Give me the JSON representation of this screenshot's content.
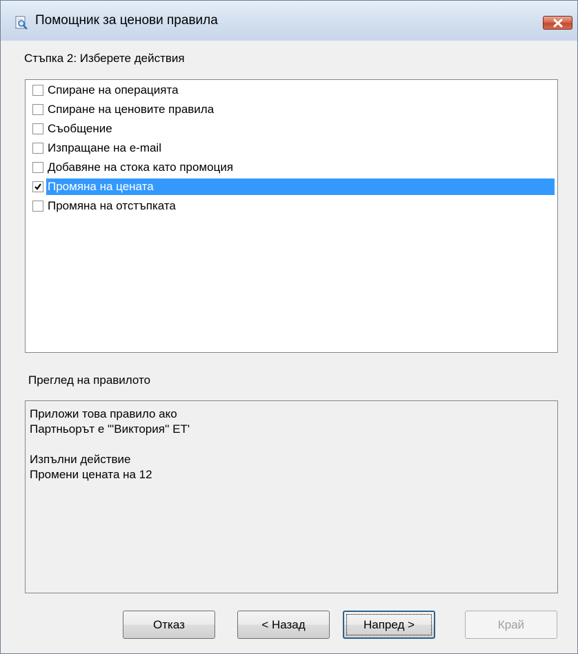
{
  "window": {
    "title": "Помощник за ценови правила",
    "icon": "magnifier-document-icon",
    "close_icon": "close-icon"
  },
  "step": {
    "label": "Стъпка 2: Изберете действия"
  },
  "actions": [
    {
      "label": "Спиране на операцията",
      "checked": false,
      "selected": false
    },
    {
      "label": "Спиране на ценовите правила",
      "checked": false,
      "selected": false
    },
    {
      "label": "Съобщение",
      "checked": false,
      "selected": false
    },
    {
      "label": "Изпращане на e-mail",
      "checked": false,
      "selected": false
    },
    {
      "label": "Добавяне на стока като промоция",
      "checked": false,
      "selected": false
    },
    {
      "label": "Промяна на цената",
      "checked": true,
      "selected": true
    },
    {
      "label": "Промяна на отстъпката",
      "checked": false,
      "selected": false
    }
  ],
  "preview": {
    "label": "Преглед на правилото",
    "lines": [
      "Приложи това правило ако",
      "Партньорът  е \"'Виктория'' ЕТ'",
      "",
      "Изпълни действие",
      "Промени цената на 12"
    ]
  },
  "buttons": {
    "cancel": "Отказ",
    "back": "< Назад",
    "next": "Напред >",
    "finish": "Край"
  },
  "colors": {
    "selection": "#3399ff",
    "dialog_bg": "#f0f0f0",
    "close_button": "#c44a30"
  }
}
